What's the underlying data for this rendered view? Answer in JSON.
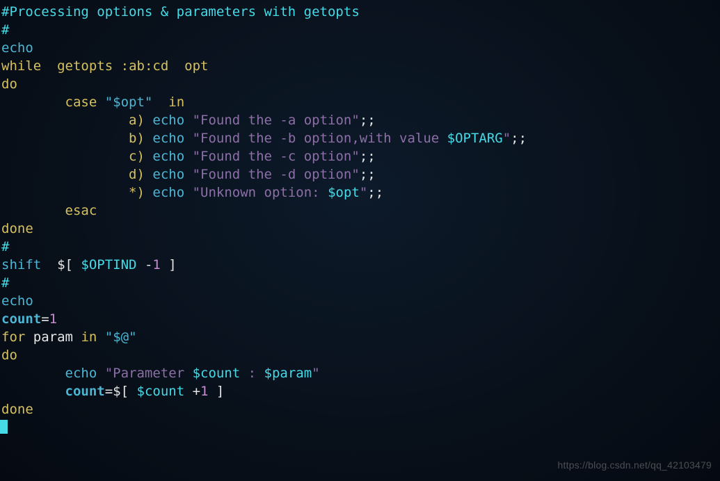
{
  "code": {
    "line1_comment": "#Processing options & parameters with getopts",
    "hash": "#",
    "echo": "echo",
    "while": "while",
    "getopts_cmd": "getopts",
    "getopts_arg": ":ab:cd",
    "opt": "opt",
    "do": "do",
    "case": "case",
    "case_var": "\"$opt\"",
    "in": "in",
    "a_label": "a)",
    "b_label": "b)",
    "c_label": "c)",
    "d_label": "d)",
    "star_label": "*)",
    "echo_kw": "echo",
    "str_a": "\"Found the -a option\"",
    "str_b_pre": "\"Found the -b option,with value ",
    "optarg": "$OPTARG",
    "str_b_post": "\"",
    "str_c": "\"Found the -c option\"",
    "str_d": "\"Found the -d option\"",
    "str_unk_pre": "\"Unknown option: ",
    "str_unk_var": "$opt",
    "str_unk_post": "\"",
    "semisemi": ";;",
    "esac": "esac",
    "done": "done",
    "shift": "shift",
    "shift_expr_open": "$[ ",
    "optind": "$OPTIND",
    "shift_expr_mid": " -",
    "one": "1",
    "shift_expr_close": " ]",
    "count": "count",
    "eq": "=",
    "count_init": "1",
    "for": "for",
    "param": "param",
    "in2": "in",
    "atq": "\"$@\"",
    "str_param_pre": "\"Parameter ",
    "count_var": "$count",
    "str_param_mid": " : ",
    "param_var": "$param",
    "str_param_post": "\"",
    "incr_open": "$[ ",
    "incr_plus": " +",
    "incr_one": "1",
    "incr_close": " ]"
  },
  "watermark": "https://blog.csdn.net/qq_42103479"
}
